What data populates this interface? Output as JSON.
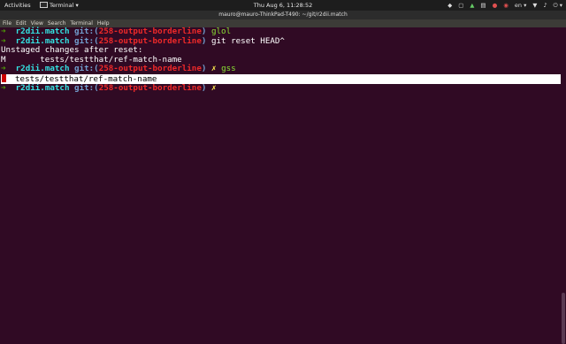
{
  "topbar": {
    "activities": "Activities",
    "app_menu": "Terminal ▾",
    "clock": "Thu Aug  6, 11:28:52",
    "tray_lang": "en ▾",
    "tray_power": "⏻ ▾"
  },
  "window": {
    "title": "mauro@mauro-ThinkPad-T490: ~/git/r2dii.match"
  },
  "menu": [
    "File",
    "Edit",
    "View",
    "Search",
    "Terminal",
    "Help"
  ],
  "terminal": {
    "arrow": "➜",
    "dir": "r2dii.match",
    "git_label": "git:(",
    "git_close": ")",
    "branch": "258-output-borderline",
    "dirty_mark": "✗",
    "line1_cmd": "glol",
    "line2_cmd": "git reset HEAD^",
    "line3": "Unstaged changes after reset:",
    "line4": "M       tests/testthat/ref-match-name",
    "line5_cmd": "gss",
    "selected_line": "tests/testthat/ref-match-name"
  },
  "colors": {
    "background": "#300a24",
    "prompt_arrow": "#4e9a06",
    "dir": "#34e2e2",
    "branch": "#ef2929"
  }
}
